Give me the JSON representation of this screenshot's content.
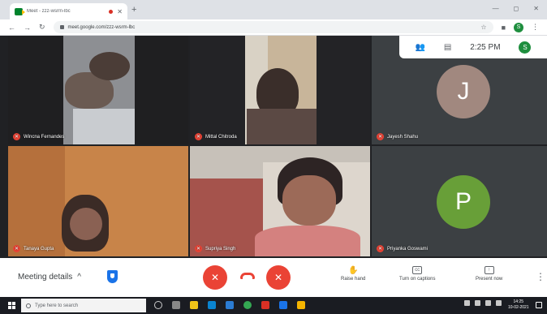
{
  "browser": {
    "tab_title": "Meet - zzz-wsrm-lbc",
    "new_tab": "+",
    "url": "meet.google.com/zzz-wsrm-lbc",
    "profile_initial": "S",
    "window_controls": [
      "—",
      "◻",
      "✕"
    ]
  },
  "meet": {
    "clock": "2:25 PM",
    "you_initial": "S",
    "participants": [
      {
        "name": "Wincna Fernandes",
        "muted": true
      },
      {
        "name": "Mittal Chitroda",
        "muted": true
      },
      {
        "name": "Jayesh Shahu",
        "muted": true,
        "avatar": "J",
        "avatar_color": "#a1887f"
      },
      {
        "name": "Tanaya Gupta",
        "muted": true
      },
      {
        "name": "Supriya Singh",
        "muted": true
      },
      {
        "name": "Priyanka Goswami",
        "muted": true,
        "avatar": "P",
        "avatar_color": "#689f38"
      }
    ]
  },
  "controls": {
    "meeting_details": "Meeting details",
    "raise_hand": "Raise hand",
    "captions": "Turn on captions",
    "present": "Present now"
  },
  "taskbar": {
    "search_placeholder": "Type here to search",
    "time": "14:25",
    "date": "10-02-2021"
  },
  "colors": {
    "danger": "#ea4335",
    "meet_bg": "#202124",
    "accent": "#1a73e8"
  }
}
